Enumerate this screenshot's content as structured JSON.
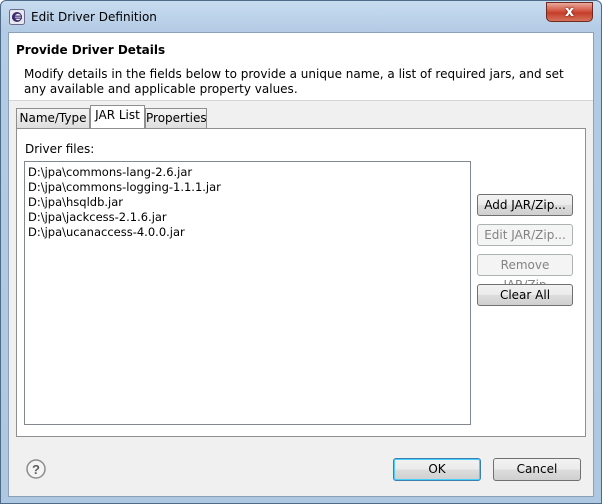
{
  "window": {
    "title": "Edit Driver Definition",
    "close_glyph": "x"
  },
  "header": {
    "title": "Provide Driver Details",
    "description": "Modify details in the fields below to provide a unique name, a list of required jars, and set any available and applicable property values."
  },
  "tabs": [
    {
      "label": "Name/Type",
      "active": false
    },
    {
      "label": "JAR List",
      "active": true
    },
    {
      "label": "Properties",
      "active": false
    }
  ],
  "jar_list": {
    "label": "Driver files:",
    "files": [
      "D:\\jpa\\commons-lang-2.6.jar",
      "D:\\jpa\\commons-logging-1.1.1.jar",
      "D:\\jpa\\hsqldb.jar",
      "D:\\jpa\\jackcess-2.1.6.jar",
      "D:\\jpa\\ucanaccess-4.0.0.jar"
    ],
    "buttons": {
      "add": "Add JAR/Zip...",
      "edit": "Edit JAR/Zip...",
      "remove": "Remove JAR/Zip",
      "clear": "Clear All"
    }
  },
  "footer": {
    "help_glyph": "?",
    "ok": "OK",
    "cancel": "Cancel"
  },
  "icons": {
    "app": "eclipse-icon",
    "close": "close-icon",
    "help": "help-icon"
  }
}
